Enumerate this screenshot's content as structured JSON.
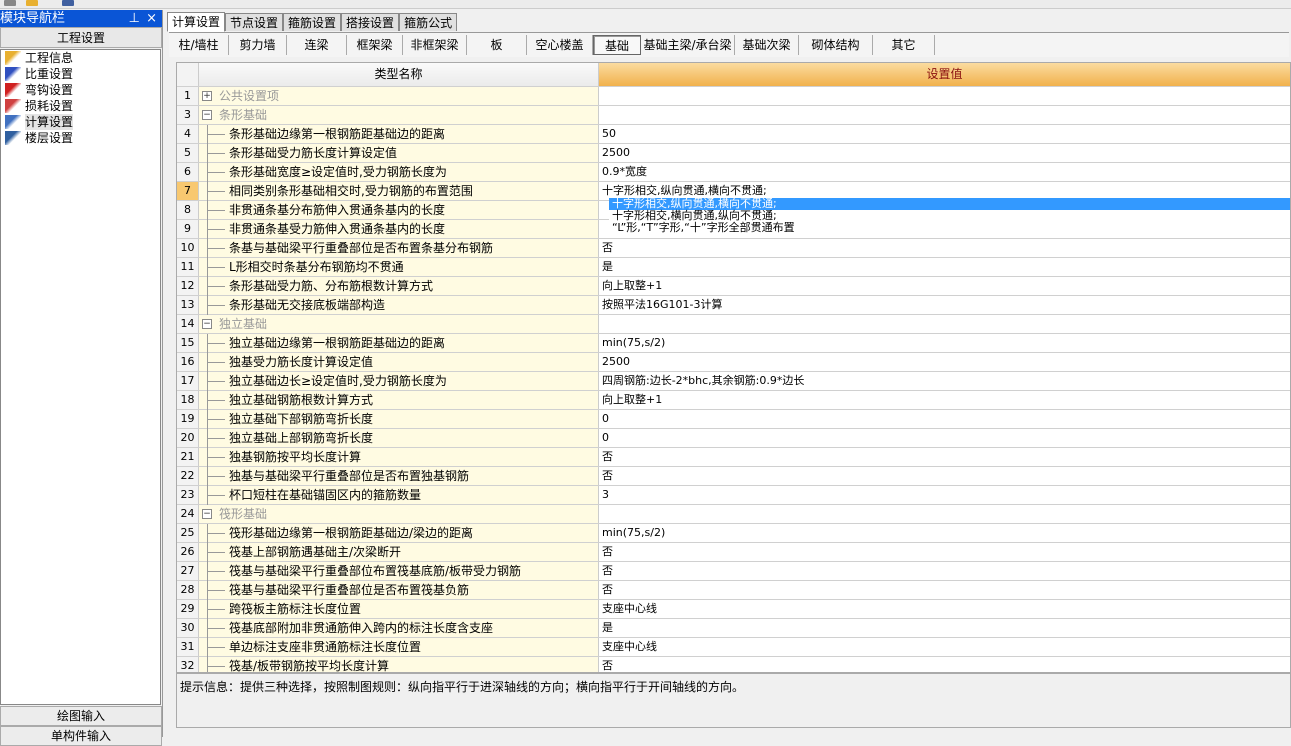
{
  "nav": {
    "title": "模块导航栏",
    "pin": "ᵖ",
    "close": "×",
    "group": "工程设置",
    "items": [
      {
        "label": "工程信息",
        "icon": "project-info-icon"
      },
      {
        "label": "比重设置",
        "icon": "weight-icon"
      },
      {
        "label": "弯钩设置",
        "icon": "hook-icon"
      },
      {
        "label": "损耗设置",
        "icon": "loss-icon"
      },
      {
        "label": "计算设置",
        "icon": "calc-icon",
        "selected": true
      },
      {
        "label": "楼层设置",
        "icon": "floor-icon"
      }
    ],
    "bottom": [
      "绘图输入",
      "单构件输入"
    ]
  },
  "tabs": [
    "计算设置",
    "节点设置",
    "箍筋设置",
    "搭接设置",
    "箍筋公式"
  ],
  "subtabs": [
    "柱/墙柱",
    "剪力墙",
    "连梁",
    "框架梁",
    "非框架梁",
    "板",
    "空心楼盖",
    "基础",
    "基础主梁/承台梁",
    "基础次梁",
    "砌体结构",
    "其它"
  ],
  "active_subtab": "基础",
  "grid": {
    "col_name": "类型名称",
    "col_value": "设置值",
    "rows": [
      {
        "n": "1",
        "name": "公共设置项",
        "group": true,
        "expander": "+",
        "value": ""
      },
      {
        "n": "3",
        "name": "条形基础",
        "group": true,
        "expander": "−",
        "value": ""
      },
      {
        "n": "4",
        "name": "条形基础边缘第一根钢筋距基础边的距离",
        "value": "50"
      },
      {
        "n": "5",
        "name": "条形基础受力筋长度计算设定值",
        "value": "2500"
      },
      {
        "n": "6",
        "name": "条形基础宽度≥设定值时,受力钢筋长度为",
        "value": "0.9*宽度"
      },
      {
        "n": "7",
        "name": "相同类别条形基础相交时,受力钢筋的布置范围",
        "value": "十字形相交,纵向贯通,横向不贯通;",
        "selected": true
      },
      {
        "n": "8",
        "name": "非贯通条基分布筋伸入贯通条基内的长度",
        "value": ""
      },
      {
        "n": "9",
        "name": "非贯通条基受力筋伸入贯通条基内的长度",
        "value": ""
      },
      {
        "n": "10",
        "name": "条基与基础梁平行重叠部位是否布置条基分布钢筋",
        "value": "否"
      },
      {
        "n": "11",
        "name": "L形相交时条基分布钢筋均不贯通",
        "value": "是"
      },
      {
        "n": "12",
        "name": "条形基础受力筋、分布筋根数计算方式",
        "value": "向上取整+1"
      },
      {
        "n": "13",
        "name": "条形基础无交接底板端部构造",
        "value": "按照平法16G101-3计算"
      },
      {
        "n": "14",
        "name": "独立基础",
        "group": true,
        "expander": "−",
        "value": ""
      },
      {
        "n": "15",
        "name": "独立基础边缘第一根钢筋距基础边的距离",
        "value": "min(75,s/2)"
      },
      {
        "n": "16",
        "name": "独基受力筋长度计算设定值",
        "value": "2500"
      },
      {
        "n": "17",
        "name": "独立基础边长≥设定值时,受力钢筋长度为",
        "value": "四周钢筋:边长-2*bhc,其余钢筋:0.9*边长"
      },
      {
        "n": "18",
        "name": "独立基础钢筋根数计算方式",
        "value": "向上取整+1"
      },
      {
        "n": "19",
        "name": "独立基础下部钢筋弯折长度",
        "value": "0"
      },
      {
        "n": "20",
        "name": "独立基础上部钢筋弯折长度",
        "value": "0"
      },
      {
        "n": "21",
        "name": "独基钢筋按平均长度计算",
        "value": "否"
      },
      {
        "n": "22",
        "name": "独基与基础梁平行重叠部位是否布置独基钢筋",
        "value": "否"
      },
      {
        "n": "23",
        "name": "杯口短柱在基础锚固区内的箍筋数量",
        "value": "3"
      },
      {
        "n": "24",
        "name": "筏形基础",
        "group": true,
        "expander": "−",
        "value": ""
      },
      {
        "n": "25",
        "name": "筏形基础边缘第一根钢筋距基础边/梁边的距离",
        "value": "min(75,s/2)"
      },
      {
        "n": "26",
        "name": "筏基上部钢筋遇基础主/次梁断开",
        "value": "否"
      },
      {
        "n": "27",
        "name": "筏基与基础梁平行重叠部位布置筏基底筋/板带受力钢筋",
        "value": "否"
      },
      {
        "n": "28",
        "name": "筏基与基础梁平行重叠部位是否布置筏基负筋",
        "value": "否"
      },
      {
        "n": "29",
        "name": "跨筏板主筋标注长度位置",
        "value": "支座中心线"
      },
      {
        "n": "30",
        "name": "筏基底部附加非贯通筋伸入跨内的标注长度含支座",
        "value": "是"
      },
      {
        "n": "31",
        "name": "单边标注支座非贯通筋标注长度位置",
        "value": "支座中心线"
      },
      {
        "n": "32",
        "name": "筏基/板带钢筋按平均长度计算",
        "value": "否"
      }
    ]
  },
  "dropdown": {
    "options": [
      "十字形相交,纵向贯通,横向不贯通;",
      "十字形相交,横向贯通,纵向不贯通;",
      "“L”形,“T”字形,“十”字形全部贯通布置"
    ],
    "highlighted": 0
  },
  "hint": "提示信息：提供三种选择，按照制图规则：纵向指平行于进深轴线的方向；横向指平行于开间轴线的方向。",
  "colors": {
    "nav_title": "#0a55d6",
    "highlight": "#3399ff",
    "name_col": "#fffbe2",
    "value_header": "#f1b14c"
  }
}
